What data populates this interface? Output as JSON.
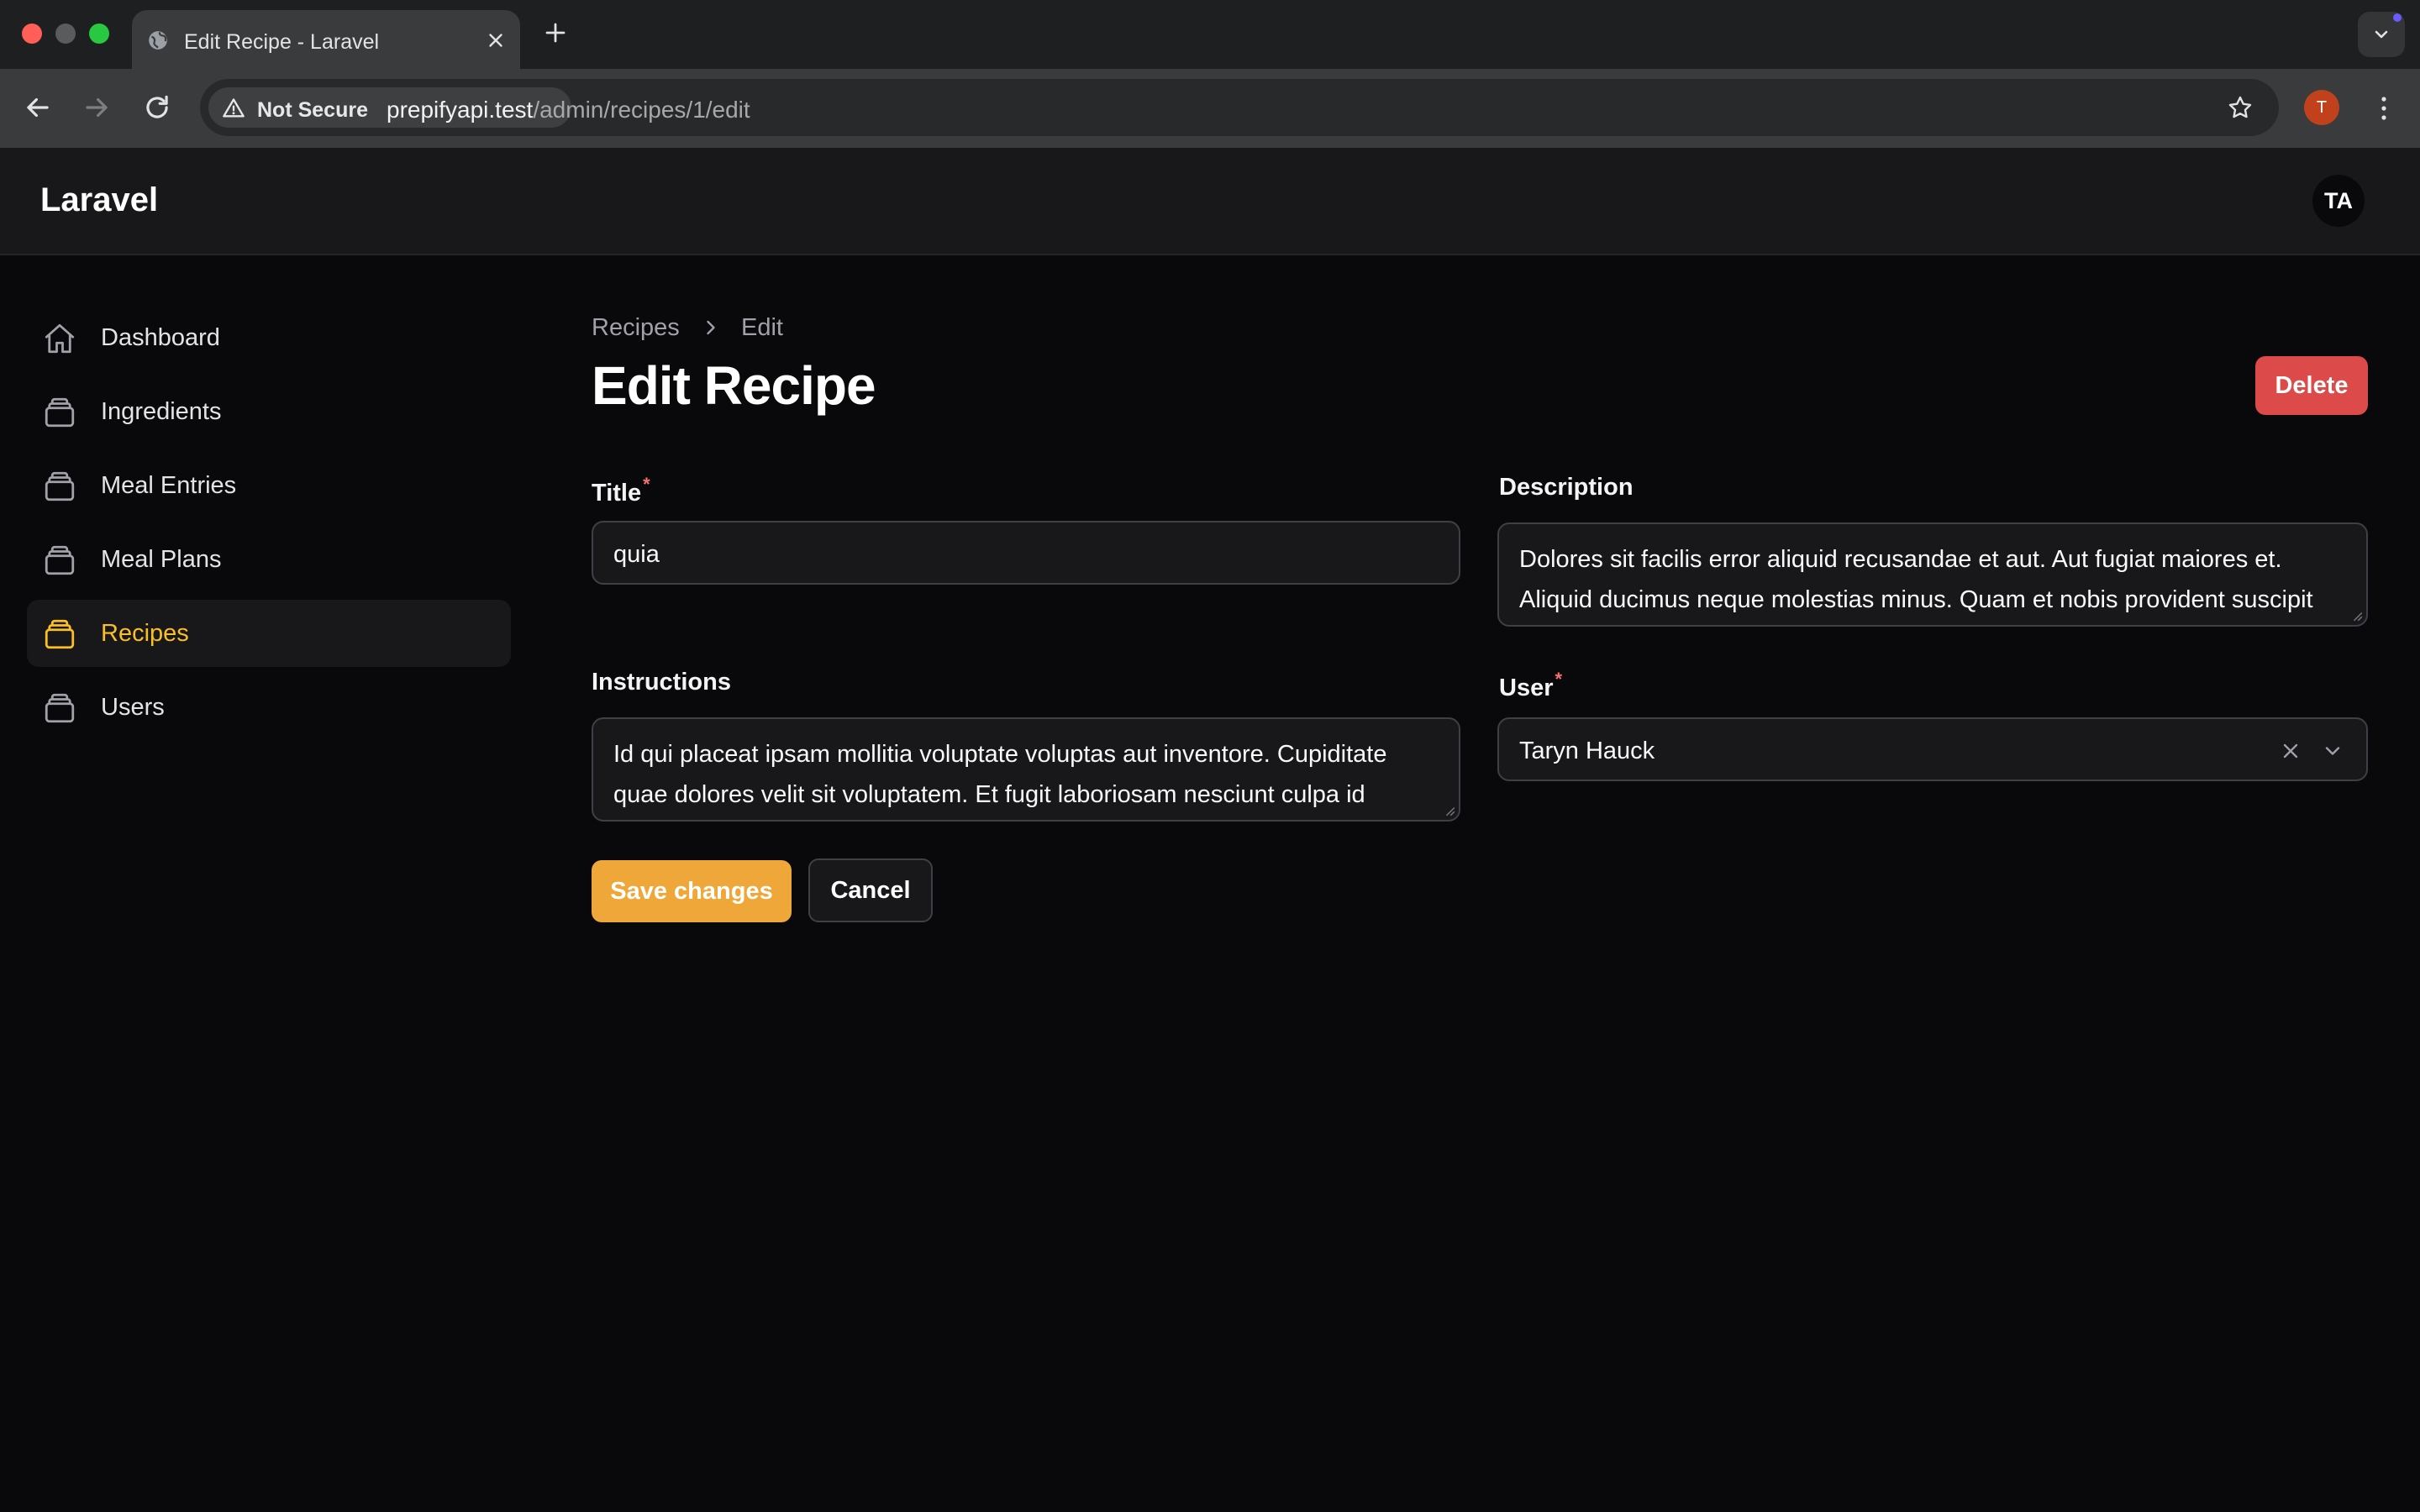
{
  "browser": {
    "tab_title": "Edit Recipe - Laravel",
    "security_label": "Not Secure",
    "url_host": "prepifyapi.test",
    "url_path": "/admin/recipes/1/edit",
    "profile_initial": "T"
  },
  "app": {
    "brand": "Laravel",
    "user_initials": "TA"
  },
  "sidebar": {
    "items": [
      {
        "label": "Dashboard",
        "icon": "home-icon"
      },
      {
        "label": "Ingredients",
        "icon": "stack-icon"
      },
      {
        "label": "Meal Entries",
        "icon": "stack-icon"
      },
      {
        "label": "Meal Plans",
        "icon": "stack-icon"
      },
      {
        "label": "Recipes",
        "icon": "stack-icon",
        "active": true
      },
      {
        "label": "Users",
        "icon": "stack-icon"
      }
    ]
  },
  "breadcrumb": {
    "parent": "Recipes",
    "current": "Edit"
  },
  "page": {
    "title": "Edit Recipe",
    "delete_label": "Delete"
  },
  "form": {
    "title_label": "Title",
    "title_value": "quia",
    "description_label": "Description",
    "description_value": "Dolores sit facilis error aliquid recusandae et aut. Aut fugiat maiores et. Aliquid ducimus neque molestias minus. Quam et nobis provident suscipit",
    "instructions_label": "Instructions",
    "instructions_value": "Id qui placeat ipsam mollitia voluptate voluptas aut inventore. Cupiditate quae dolores velit sit voluptatem. Et fugit laboriosam nesciunt culpa id",
    "user_label": "User",
    "user_value": "Taryn Hauck",
    "required_marker": "*",
    "save_label": "Save changes",
    "cancel_label": "Cancel"
  },
  "colors": {
    "accent": "#f0a73a",
    "active_nav": "#fbbf24",
    "danger": "#dc4a4a",
    "background": "#09090b"
  }
}
